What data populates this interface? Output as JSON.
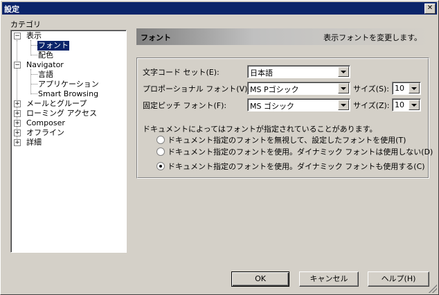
{
  "window": {
    "title": "設定",
    "close_glyph": "✕"
  },
  "category": {
    "label": "カテゴリ",
    "tree": [
      {
        "label": "表示",
        "exp": "−"
      },
      {
        "label": "フォント"
      },
      {
        "label": "配色"
      },
      {
        "label": "Navigator",
        "exp": "−"
      },
      {
        "label": "言語"
      },
      {
        "label": "アプリケーション"
      },
      {
        "label": "Smart Browsing"
      },
      {
        "label": "メールとグループ",
        "exp": "+"
      },
      {
        "label": "ローミング アクセス",
        "exp": "+"
      },
      {
        "label": "Composer",
        "exp": "+"
      },
      {
        "label": "オフライン",
        "exp": "+"
      },
      {
        "label": "詳細",
        "exp": "+"
      }
    ]
  },
  "panel": {
    "title": "フォント",
    "description": "表示フォントを変更します。",
    "charset_label": "文字コード セット(E):",
    "charset_value": "日本語",
    "proportional_label": "プロポーショナル フォント(V):",
    "proportional_value": "MS Pゴシック",
    "proportional_size_label": "サイズ(S):",
    "proportional_size_value": "10",
    "fixed_label": "固定ピッチ フォント(F):",
    "fixed_value": "MS ゴシック",
    "fixed_size_label": "サイズ(Z):",
    "fixed_size_value": "10",
    "note": "ドキュメントによってはフォントが指定されていることがあります。",
    "options": [
      {
        "label": "ドキュメント指定のフォントを無視して、設定したフォントを使用(T)",
        "checked": false
      },
      {
        "label": "ドキュメント指定のフォントを使用。ダイナミック フォントは使用しない(D)",
        "checked": false
      },
      {
        "label": "ドキュメント指定のフォントを使用。ダイナミック フォントも使用する(C)",
        "checked": true
      }
    ]
  },
  "buttons": {
    "ok": "OK",
    "cancel": "キャンセル",
    "help": "ヘルプ(H)"
  }
}
